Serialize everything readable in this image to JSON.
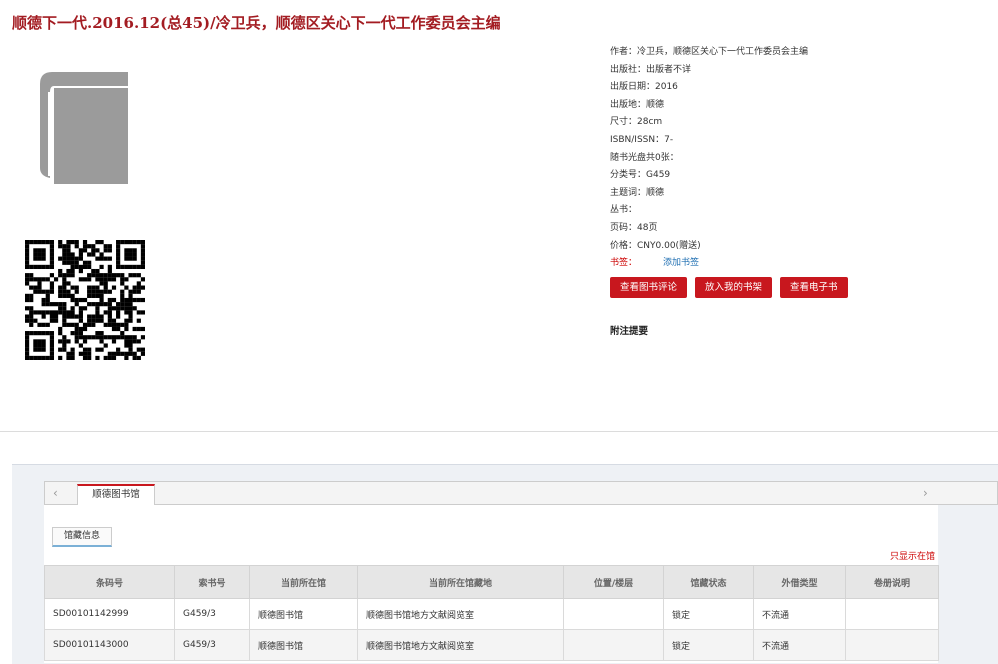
{
  "record": {
    "title": "顺德下一代.2016.12(总45)/冷卫兵，顺德区关心下一代工作委员会主编"
  },
  "metadata": [
    "作者：冷卫兵，顺德区关心下一代工作委员会主编",
    "出版社：出版者不详",
    "出版日期：2016",
    "出版地：顺德",
    "尺寸：28cm",
    "ISBN/ISSN：7-",
    "随书光盘共0张：",
    "分类号：G459",
    "主题词：顺德",
    "丛书：",
    "页码：48页",
    "价格：CNY0.00(赠送)"
  ],
  "bookmark": {
    "label": "书签：",
    "add_label": "添加书签"
  },
  "actions": {
    "review": "查看图书评论",
    "shelf": "放入我的书架",
    "ebook": "查看电子书"
  },
  "notes_heading": "附注提要",
  "library_tab": "顺德图书馆",
  "sub_tab": "馆藏信息",
  "only_show": "只显示在馆",
  "table": {
    "headers": [
      "条码号",
      "索书号",
      "当前所在馆",
      "当前所在馆藏地",
      "位置/楼层",
      "馆藏状态",
      "外借类型",
      "卷册说明"
    ],
    "rows": [
      [
        "SD00101142999",
        "G459/3",
        "顺德图书馆",
        "顺德图书馆地方文献阅览室",
        "",
        "锁定",
        "不流通",
        ""
      ],
      [
        "SD00101143000",
        "G459/3",
        "顺德图书馆",
        "顺德图书馆地方文献阅览室",
        "",
        "锁定",
        "不流通",
        ""
      ]
    ]
  }
}
